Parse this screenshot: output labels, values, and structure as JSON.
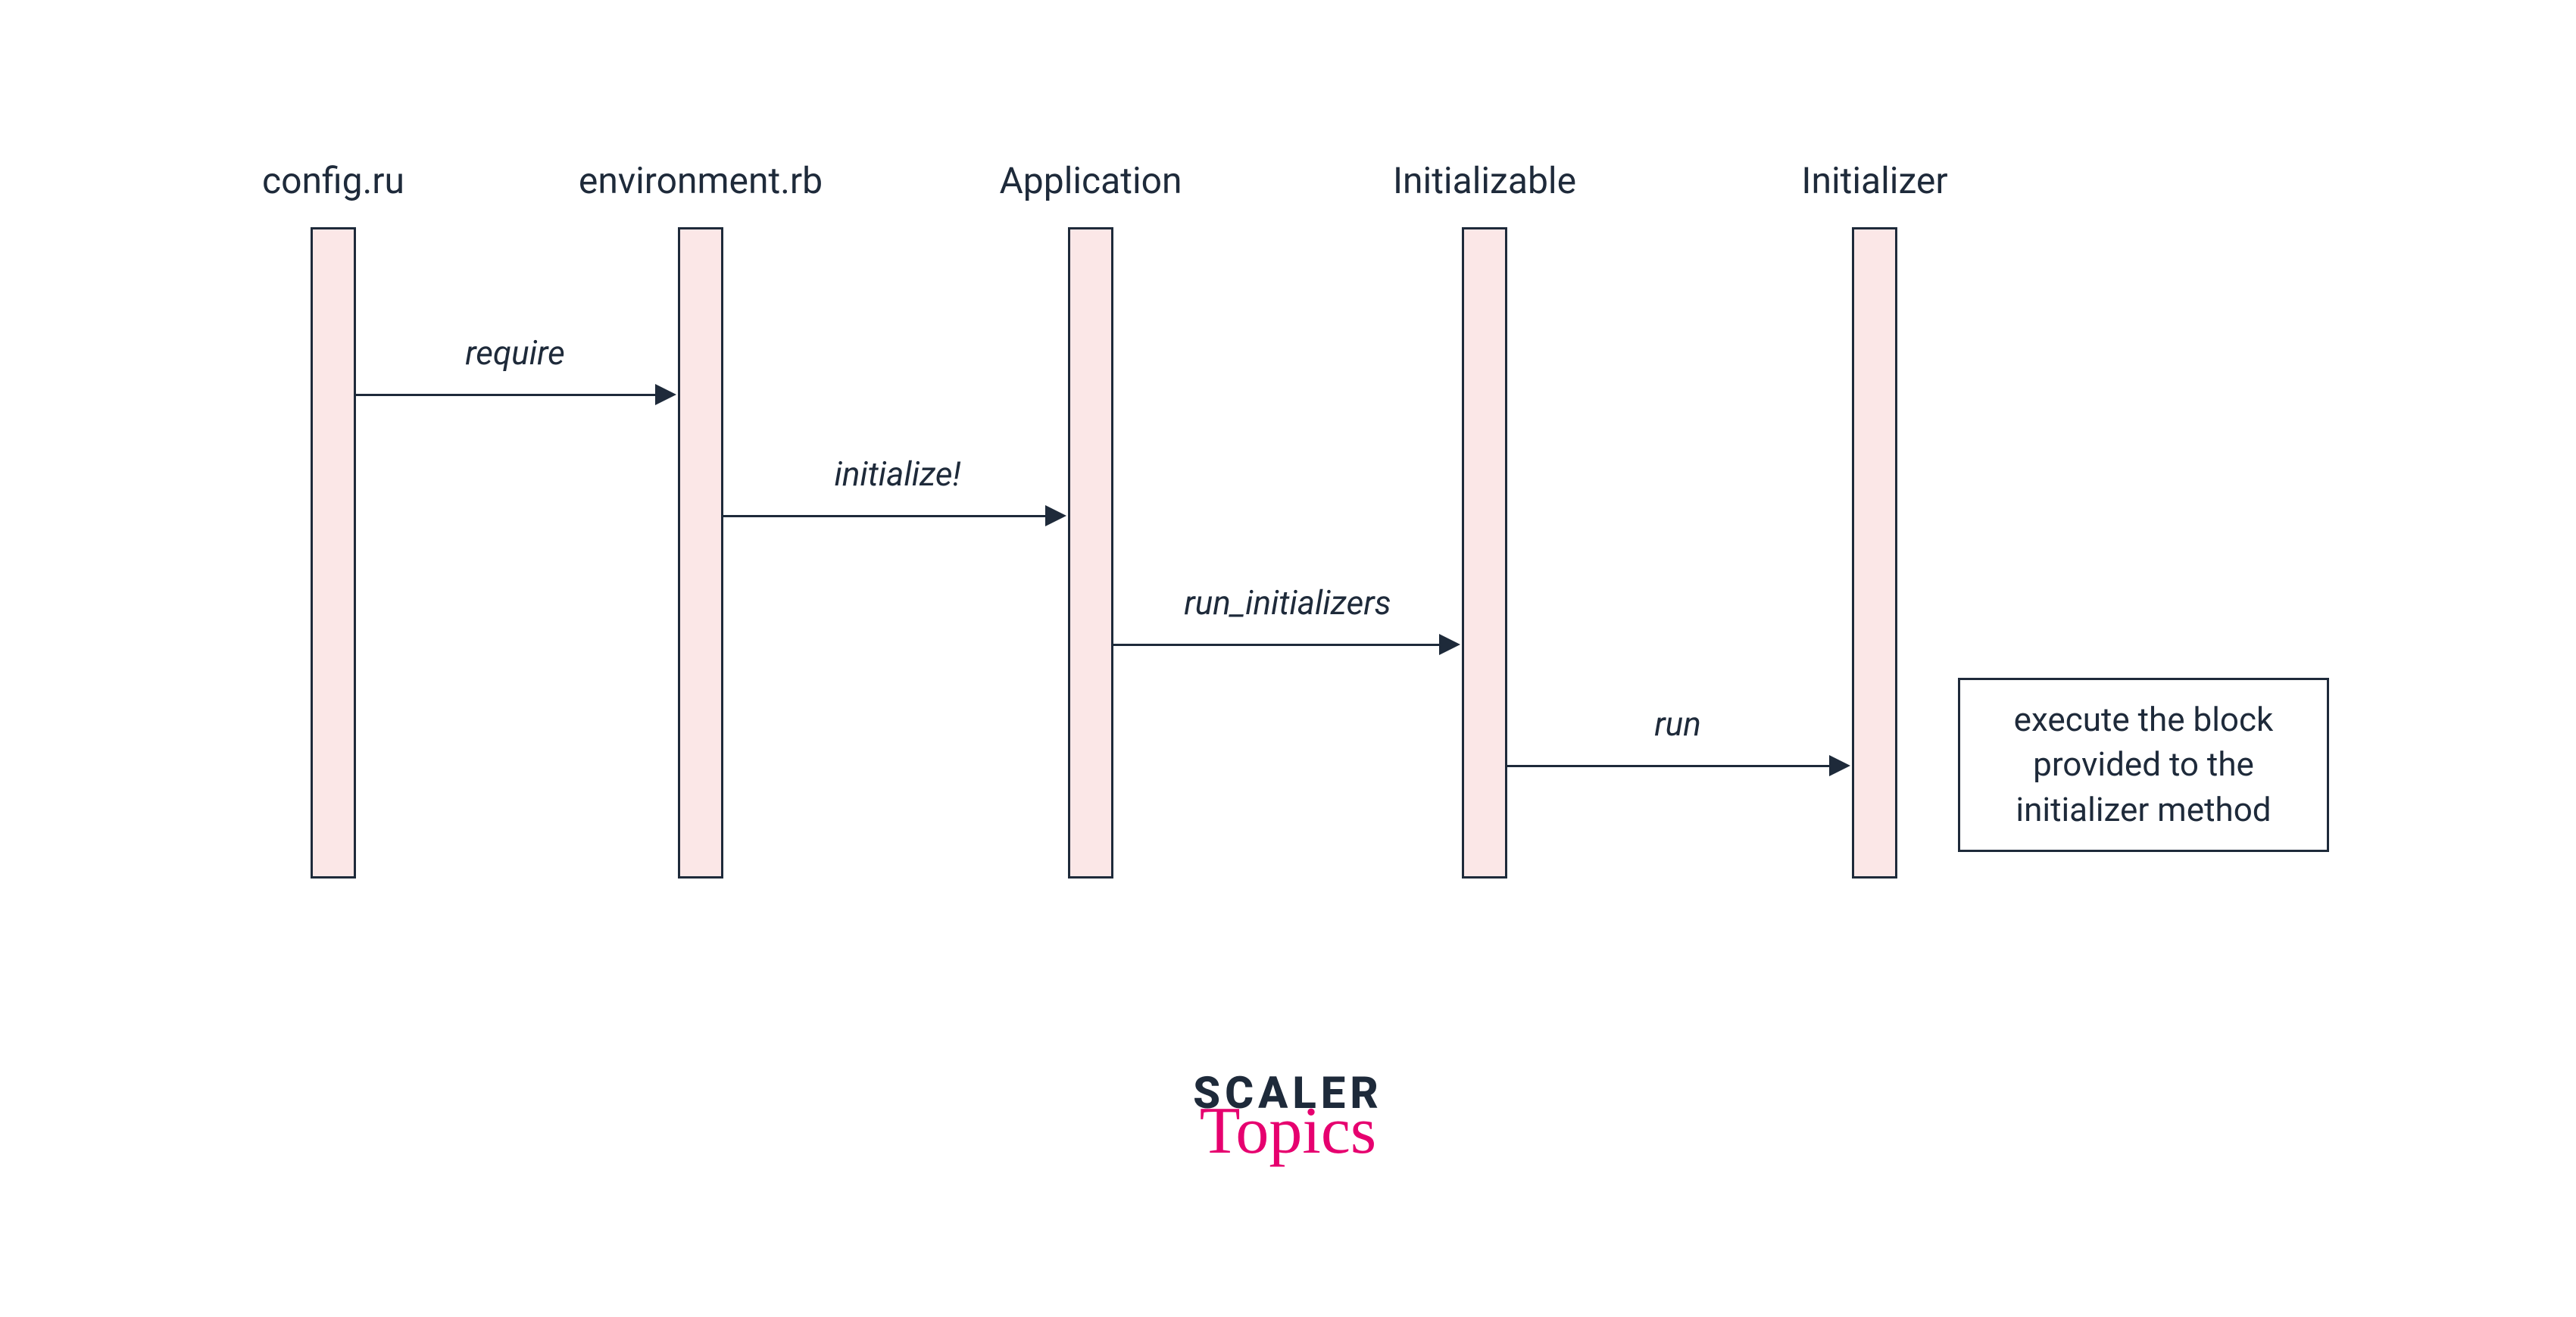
{
  "lifelines": {
    "l1": {
      "label": "config.ru"
    },
    "l2": {
      "label": "environment.rb"
    },
    "l3": {
      "label": "Application"
    },
    "l4": {
      "label": "Initializable"
    },
    "l5": {
      "label": "Initializer"
    }
  },
  "messages": {
    "m1": {
      "label": "require"
    },
    "m2": {
      "label": "initialize!"
    },
    "m3": {
      "label": "run_initializers"
    },
    "m4": {
      "label": "run"
    }
  },
  "note": {
    "text": "execute the block provided to the initializer method"
  },
  "logo": {
    "line1": "SCALER",
    "line2": "Topics"
  }
}
